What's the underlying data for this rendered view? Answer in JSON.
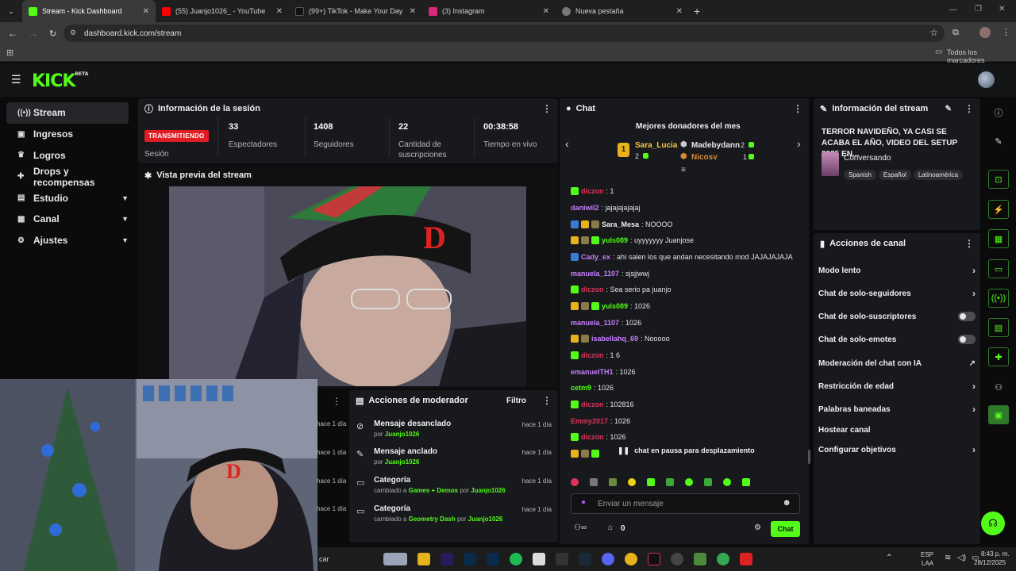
{
  "browser": {
    "tabs": [
      {
        "title": "Stream - Kick Dashboard",
        "color": "#53fc18"
      },
      {
        "title": "(55) Juanjo1026_ - YouTube",
        "color": "#ff0000"
      },
      {
        "title": "(99+) TikTok - Make Your Day",
        "color": "#111111"
      },
      {
        "title": "(3) Instagram",
        "color": "#d62976"
      },
      {
        "title": "Nueva pestaña",
        "color": "#777777"
      }
    ],
    "url": "dashboard.kick.com/stream",
    "bookmarks_label": "Todos los marcadores"
  },
  "kick": {
    "logo": "KICK",
    "logo_sup": "BETA"
  },
  "sidebar": {
    "items": [
      {
        "label": "Stream",
        "icon": "broadcast-icon"
      },
      {
        "label": "Ingresos",
        "icon": "wallet-icon"
      },
      {
        "label": "Logros",
        "icon": "trophy-icon"
      },
      {
        "label": "Drops y recompensas",
        "icon": "gift-icon"
      },
      {
        "label": "Estudio",
        "icon": "studio-icon"
      },
      {
        "label": "Canal",
        "icon": "channel-icon"
      },
      {
        "label": "Ajustes",
        "icon": "gear-icon"
      }
    ]
  },
  "session": {
    "title": "Información de la sesión",
    "live_badge": "TRANSMITIENDO",
    "live_label": "Sesión",
    "stats": [
      {
        "value": "33",
        "label": "Espectadores"
      },
      {
        "value": "1408",
        "label": "Seguidores"
      },
      {
        "value": "22",
        "label": "Cantidad de suscripciones"
      },
      {
        "value": "00:38:58",
        "label": "Tiempo en vivo"
      }
    ]
  },
  "preview": {
    "title": "Vista previa del stream"
  },
  "mod_actions": {
    "title": "Acciones de moderador",
    "filter": "Filtro",
    "items": [
      {
        "title": "Mensaje desanclado",
        "prefix": "por",
        "user": "Juanjo1026",
        "detail": "",
        "time": "hace 1 día"
      },
      {
        "title": "Mensaje anclado",
        "prefix": "por",
        "user": "Juanjo1026",
        "detail": "",
        "time": "hace 1 día"
      },
      {
        "title": "Categoría",
        "prefix": "cambiado a",
        "detail": "Games + Demos",
        "by": "por",
        "user": "Juanjo1026",
        "time": "hace 1 día"
      },
      {
        "title": "Categoría",
        "prefix": "cambiado a",
        "detail": "Geometry Dash",
        "by": "por",
        "user": "Juanjo1026",
        "time": "hace 1 día"
      }
    ],
    "left_times": [
      "hace 1 día",
      "hace 1 día",
      "hace 1 día",
      "hace 1 día"
    ]
  },
  "chat": {
    "title": "Chat",
    "donors_title": "Mejores donadores del mes",
    "donors": [
      {
        "name": "Sara_Lucia",
        "amount": "2"
      },
      {
        "name": "Madebydann",
        "amount": "2"
      },
      {
        "name": "Nicosv",
        "amount": "1"
      }
    ],
    "messages": [
      {
        "user": "diczon",
        "text": ": 1",
        "color": "#e0325a"
      },
      {
        "user": "daniwil2",
        "text": ": jajajajajajaj",
        "color": "#c77dff"
      },
      {
        "user": "Sara_Mesa",
        "text": ": NOOOO",
        "color": "#f0f0f0"
      },
      {
        "user": "yuls089",
        "text": ": uyyyyyyy Juanjose",
        "color": "#53fc18"
      },
      {
        "user": "Cady_ex",
        "text": ": ahí salen los que andan necesitando mod JAJAJAJAJA",
        "color": "#c77dff"
      },
      {
        "user": "manuela_1107",
        "text": ": sjsjjwwj",
        "color": "#c77dff"
      },
      {
        "user": "diczon",
        "text": ": Sea serio pa juanjo",
        "color": "#e0325a"
      },
      {
        "user": "yuls089",
        "text": ": 1026",
        "color": "#53fc18"
      },
      {
        "user": "manuela_1107",
        "text": ": 1026",
        "color": "#c77dff"
      },
      {
        "user": "isabellahq_69",
        "text": ": Nooooo",
        "color": "#c77dff"
      },
      {
        "user": "diczon",
        "text": ": 1 6",
        "color": "#e0325a"
      },
      {
        "user": "emanuelTH1",
        "text": ": 1026",
        "color": "#c77dff"
      },
      {
        "user": "cetm9",
        "text": ": 1026",
        "color": "#53fc18"
      },
      {
        "user": "diczon",
        "text": ": 102816",
        "color": "#e0325a"
      },
      {
        "user": "Emmy2017",
        "text": ": 1026",
        "color": "#e0325a"
      },
      {
        "user": "diczon",
        "text": ": 1026",
        "color": "#e0325a"
      }
    ],
    "paused": "chat en pausa para desplazamiento",
    "input_placeholder": "Enviar un mensaje",
    "send_label": "Chat",
    "points": "0"
  },
  "stream_info": {
    "title": "Información del stream",
    "stream_title": "TERROR NAVIDEÑO, YA CASI SE ACABA EL AÑO, VIDEO DEL SETUP 2025 EN...",
    "category": "Conversando",
    "tags": [
      "Spanish",
      "Español",
      "Latinoamérica"
    ]
  },
  "channel_actions": {
    "title": "Acciones de canal",
    "items": [
      {
        "label": "Modo lento",
        "kind": "chevron"
      },
      {
        "label": "Chat de solo-seguidores",
        "kind": "chevron"
      },
      {
        "label": "Chat de solo-suscriptores",
        "kind": "toggle"
      },
      {
        "label": "Chat de solo-emotes",
        "kind": "toggle"
      },
      {
        "label": "Moderación del chat con IA",
        "kind": "external"
      },
      {
        "label": "Restricción de edad",
        "kind": "chevron"
      },
      {
        "label": "Palabras baneadas",
        "kind": "chevron"
      },
      {
        "label": "Hostear canal",
        "kind": "none"
      },
      {
        "label": "Configurar objetivos",
        "kind": "chevron"
      }
    ]
  },
  "taskbar": {
    "search": "car",
    "lang1": "ESP",
    "lang2": "LAA",
    "time": "8:43 p. m.",
    "date": "28/12/2025"
  },
  "colors": {
    "accent": "#53fc18",
    "live": "#e01d24",
    "panel": "#18191c"
  }
}
